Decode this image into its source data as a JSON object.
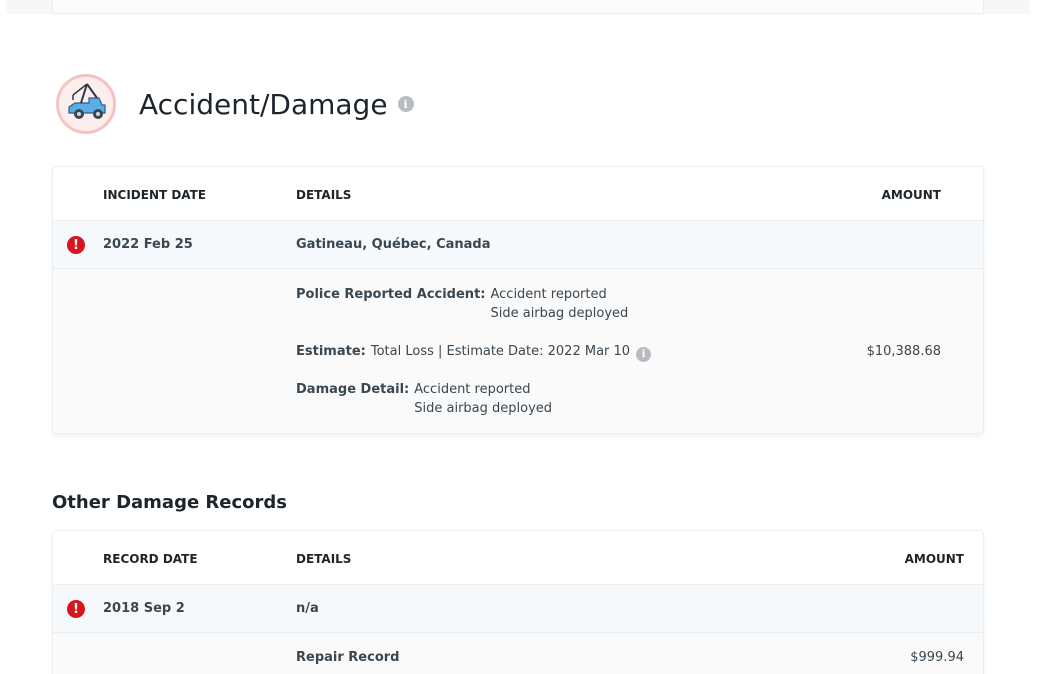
{
  "section": {
    "title": "Accident/Damage",
    "logo_icon": "tow-truck-icon",
    "info_icon": "info-icon"
  },
  "accident_table": {
    "headers": {
      "date": "INCIDENT DATE",
      "details": "DETAILS",
      "amount": "AMOUNT"
    },
    "record": {
      "date": "2022 Feb 25",
      "location": "Gatineau, Québec, Canada",
      "police_label": "Police Reported Accident:",
      "police_values": [
        "Accident reported",
        "Side airbag deployed"
      ],
      "estimate_label": "Estimate:",
      "estimate_value": "Total Loss | Estimate Date: 2022 Mar 10",
      "estimate_amount": "$10,388.68",
      "damage_label": "Damage Detail:",
      "damage_values": [
        "Accident reported",
        "Side airbag deployed"
      ]
    }
  },
  "other_damage": {
    "title": "Other Damage Records",
    "headers": {
      "date": "RECORD DATE",
      "details": "DETAILS",
      "amount": "AMOUNT"
    },
    "record": {
      "date": "2018 Sep 2",
      "details": "n/a",
      "repair_label": "Repair Record",
      "repair_amount": "$999.94"
    }
  },
  "colors": {
    "alert": "#d9141f",
    "highlight_row": "#f5f9fc",
    "logo_ring": "#f2c4c2"
  }
}
